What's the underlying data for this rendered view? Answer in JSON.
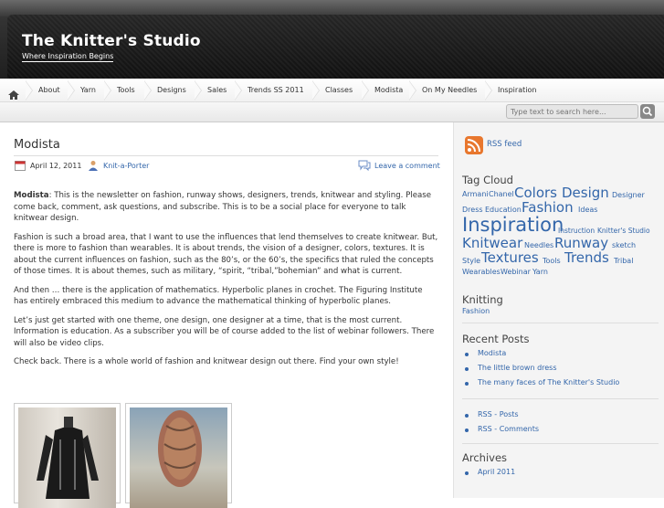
{
  "site": {
    "title": "The Knitter's Studio",
    "description": "Where Inspiration Begins"
  },
  "nav": {
    "items": [
      "About",
      "Yarn",
      "Tools",
      "Designs",
      "Sales",
      "Trends SS 2011",
      "Classes",
      "Modista",
      "On My Needles",
      "Inspiration"
    ]
  },
  "search": {
    "placeholder": "Type text to search here..."
  },
  "post": {
    "title": "Modista",
    "date": "April 12, 2011",
    "author": "Knit-a-Porter",
    "comment_link": "Leave a comment",
    "p1_strong": "Modista",
    "p1": ": This is the newsletter on fashion, runway shows, designers, trends, knitwear and styling. Please come back, comment, ask questions, and subscribe. This is to be a social place for everyone to talk knitwear design.",
    "p2": "Fashion is such a broad area, that I want to use the influences that lend themselves to create knitwear. But, there is more to fashion than wearables. It is about trends, the vision of a designer, colors, textures. It is about the current influences on fashion, such as the 80’s, or the 60’s, the specifics that ruled the concepts of those times. It is about themes, such as military, “spirit, “tribal,”bohemian” and what is current.",
    "p3": "And then … there is the application of mathematics. Hyperbolic planes in crochet. The Figuring Institute has entirely embraced this medium to advance the mathematical thinking of hyperbolic planes.",
    "p4": "Let’s just get started with one theme, one design, one designer at a time, that is the most current. Information is education. As a subscriber you will be of course added to the list of webinar followers. There will also be video clips.",
    "p5": "Check back. There is a whole world of fashion and knitwear design out there. Find your own style!"
  },
  "sidebar": {
    "rss_feed": "RSS feed",
    "tag_cloud_title": "Tag Cloud",
    "tags": [
      "Armani",
      "Chanel",
      "Colors",
      "Design",
      "Designer",
      "Dress",
      "Education",
      "Fashion",
      "Ideas",
      "Inspiration",
      "Instruction",
      "Knitter's Studio",
      "Knitwear",
      "Needles",
      "Runway",
      "sketch",
      "Style",
      "Textures",
      "Tools",
      "Trends",
      "Tribal",
      "Wearables",
      "Webinar",
      "Yarn"
    ],
    "knitting_title": "Knitting",
    "knitting_link": "Fashion",
    "recent_title": "Recent Posts",
    "recent": [
      "Modista",
      "The little brown dress",
      "The many faces of The Knitter's Studio"
    ],
    "rss_links": [
      "RSS - Posts",
      "RSS - Comments"
    ],
    "archives_title": "Archives",
    "archives": [
      "April 2011"
    ]
  },
  "colors": {
    "link": "#3366aa",
    "header": "#1f1f1f"
  }
}
